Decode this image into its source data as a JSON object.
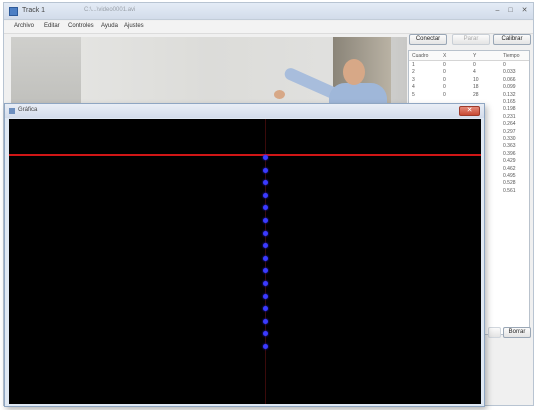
{
  "app": {
    "title": "Track 1",
    "path": "C:\\...\\video0001.avi",
    "window_controls": [
      "–",
      "□",
      "✕"
    ]
  },
  "menu": [
    "Archivo",
    "Editar",
    "Controles",
    "Ayuda",
    "Ajustes"
  ],
  "side_buttons": [
    {
      "label": "Conectar",
      "enabled": true
    },
    {
      "label": "Parar",
      "enabled": false
    },
    {
      "label": "Calibrar",
      "enabled": true
    }
  ],
  "table": {
    "columns": [
      "Cuadro",
      "X",
      "Y",
      "Tiempo"
    ],
    "rows": [
      [
        "1",
        "0",
        "0",
        "0"
      ],
      [
        "2",
        "0",
        "4",
        "0.033"
      ],
      [
        "3",
        "0",
        "10",
        "0.066"
      ],
      [
        "4",
        "0",
        "18",
        "0.099"
      ],
      [
        "5",
        "0",
        "28",
        "0.132"
      ],
      [
        "",
        "",
        "",
        "0.165"
      ],
      [
        "",
        "",
        "",
        "0.198"
      ],
      [
        "",
        "",
        "",
        "0.231"
      ],
      [
        "",
        "",
        "",
        "0.264"
      ],
      [
        "",
        "",
        "",
        "0.297"
      ],
      [
        "",
        "",
        "",
        "0.330"
      ],
      [
        "",
        "",
        "",
        "0.363"
      ],
      [
        "",
        "",
        "",
        "0.396"
      ],
      [
        "",
        "",
        "",
        "0.429"
      ],
      [
        "",
        "",
        "",
        "0.462"
      ],
      [
        "",
        "",
        "",
        "0.495"
      ],
      [
        "",
        "",
        "",
        "0.528"
      ],
      [
        "",
        "",
        "",
        "0.561"
      ]
    ]
  },
  "bottom_button": "Borrar",
  "display": {
    "title": "Gráfica",
    "close_label": "✕",
    "track_point_count": 16,
    "track_color": "#3b3bff",
    "guide_color": "#d01616"
  }
}
